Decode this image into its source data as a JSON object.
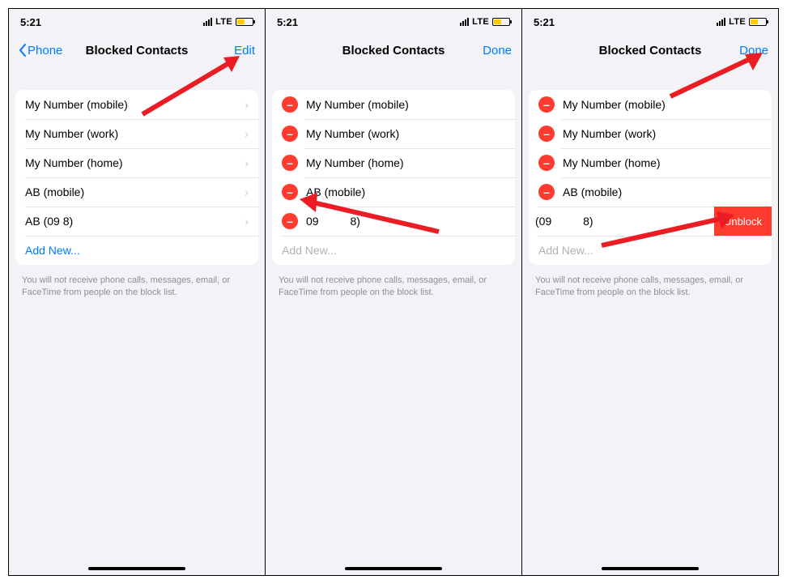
{
  "status": {
    "time": "5:21",
    "carrier": "LTE"
  },
  "nav": {
    "back_label": "Phone",
    "title": "Blocked Contacts",
    "edit_label": "Edit",
    "done_label": "Done"
  },
  "screen1": {
    "rows": [
      {
        "label": "My Number (mobile)"
      },
      {
        "label": "My Number (work)"
      },
      {
        "label": "My Number (home)"
      },
      {
        "label": "AB (mobile)"
      },
      {
        "label": "AB (09          8)"
      }
    ],
    "add_new": "Add New..."
  },
  "screen2": {
    "rows": [
      {
        "label": "My Number (mobile)"
      },
      {
        "label": "My Number (work)"
      },
      {
        "label": "My Number (home)"
      },
      {
        "label": "AB (mobile)"
      },
      {
        "label": "09          8)"
      }
    ],
    "add_new": "Add New..."
  },
  "screen3": {
    "rows": [
      {
        "label": "My Number (mobile)"
      },
      {
        "label": "My Number (work)"
      },
      {
        "label": "My Number (home)"
      },
      {
        "label": "AB (mobile)"
      }
    ],
    "swiped_label": "(09          8)",
    "unblock_label": "Unblock",
    "add_new": "Add New..."
  },
  "footer_text": "You will not receive phone calls, messages, email, or FaceTime from people on the block list."
}
